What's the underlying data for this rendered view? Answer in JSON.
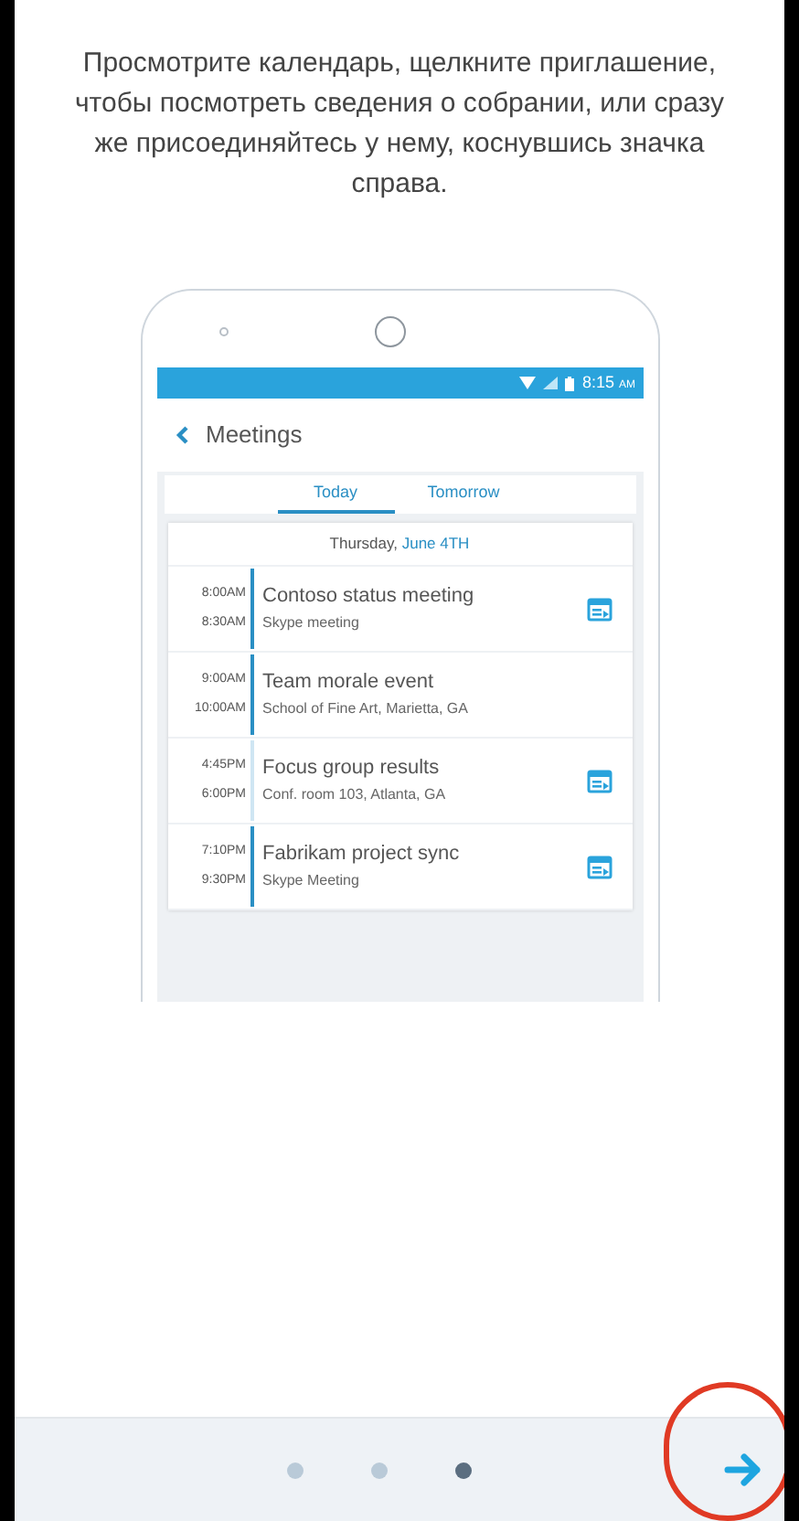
{
  "instruction": "Просмотрите календарь, щелкните приглашение, чтобы посмотреть сведения о собрании, или сразу же присоединяйтесь у нему, коснувшись значка справа.",
  "phone": {
    "status_time": "8:15",
    "status_ampm": "AM",
    "title": "Meetings",
    "tabs": [
      {
        "label": "Today",
        "selected": true
      },
      {
        "label": "Tomorrow",
        "selected": false
      }
    ],
    "date_day": "Thursday,",
    "date_rest": "June 4TH",
    "meetings": [
      {
        "start": "8:00AM",
        "end": "8:30AM",
        "title": "Contoso status meeting",
        "location": "Skype meeting",
        "color": "#2a8fc4",
        "online": true
      },
      {
        "start": "9:00AM",
        "end": "10:00AM",
        "title": "Team morale event",
        "location": "School of Fine Art, Marietta, GA",
        "color": "#2a8fc4",
        "online": false
      },
      {
        "start": "4:45PM",
        "end": "6:00PM",
        "title": "Focus group results",
        "location": "Conf. room 103, Atlanta, GA",
        "color": "#cfe6f3",
        "online": true
      },
      {
        "start": "7:10PM",
        "end": "9:30PM",
        "title": "Fabrikam project sync",
        "location": "Skype Meeting",
        "color": "#2a8fc4",
        "online": true
      }
    ]
  },
  "pager": [
    {
      "selected": false
    },
    {
      "selected": false
    },
    {
      "selected": true
    }
  ],
  "next_highlighted": true
}
